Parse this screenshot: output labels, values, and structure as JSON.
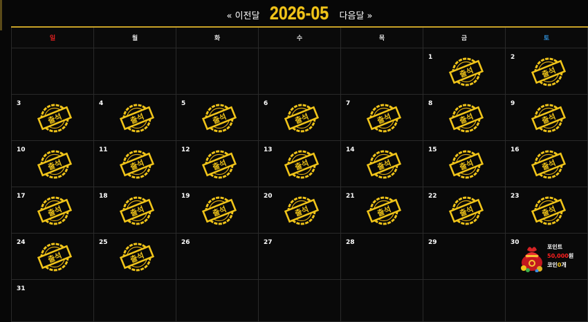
{
  "nav": {
    "prev_label": "« 이전달",
    "month_title": "2026-05",
    "next_label": "다음달 »"
  },
  "weekdays": [
    "일",
    "월",
    "화",
    "수",
    "목",
    "금",
    "토"
  ],
  "stamp_text": "출석",
  "days": {
    "d1": "1",
    "d2": "2",
    "d3": "3",
    "d4": "4",
    "d5": "5",
    "d6": "6",
    "d7": "7",
    "d8": "8",
    "d9": "9",
    "d10": "10",
    "d11": "11",
    "d12": "12",
    "d13": "13",
    "d14": "14",
    "d15": "15",
    "d16": "16",
    "d17": "17",
    "d18": "18",
    "d19": "19",
    "d20": "20",
    "d21": "21",
    "d22": "22",
    "d23": "23",
    "d24": "24",
    "d25": "25",
    "d26": "26",
    "d27": "27",
    "d28": "28",
    "d29": "29",
    "d30": "30",
    "d31": "31"
  },
  "reward": {
    "point_label": "포인트",
    "amount": "50,000",
    "amount_unit": "원",
    "coin_label": "코인",
    "coin_count": "0",
    "coin_unit": "개"
  },
  "colors": {
    "accent_gold": "#f0c419",
    "sunday_red": "#e02020",
    "saturday_blue": "#2f8fd8"
  },
  "icons": {
    "stamp": "attendance-stamp-icon",
    "reward": "lucky-bag-icon"
  }
}
